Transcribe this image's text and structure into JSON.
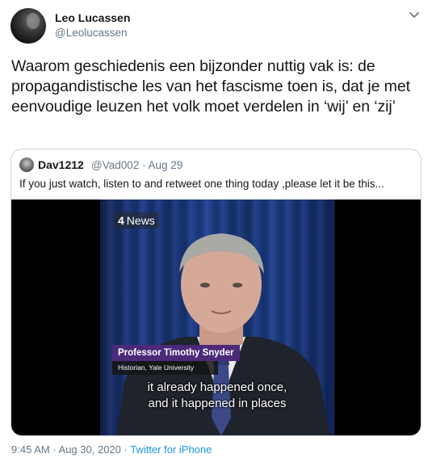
{
  "author": {
    "display_name": "Leo Lucassen",
    "handle": "@Leolucassen"
  },
  "tweet": {
    "text": "Waarom geschiedenis een bijzonder nuttig vak is: de propagandistische les van het fascisme toen is, dat je met eenvoudige leuzen het volk moet verdelen in ‘wij’ en ‘zij’",
    "time": "9:45 AM · Aug 30, 2020 · ",
    "source": "Twitter for iPhone"
  },
  "quoted": {
    "display_name": "Dav1212",
    "handle_date": "@Vad002 · Aug 29",
    "text": "If you just watch, listen to and retweet one thing today ,please let it be this..."
  },
  "video": {
    "logo_number": "4",
    "logo_text": "News",
    "name_caption": "Professor Timothy Snyder",
    "role_caption": "Historian, Yale University",
    "subtitle_line1": "it already happened once,",
    "subtitle_line2": "and it happened in places"
  },
  "colors": {
    "link_blue": "#1b95e0",
    "secondary_text": "#657786",
    "border": "#ccd6dd",
    "caption_purple": "#4b2a7a"
  },
  "icons": {
    "menu": "chevron-down-icon"
  }
}
